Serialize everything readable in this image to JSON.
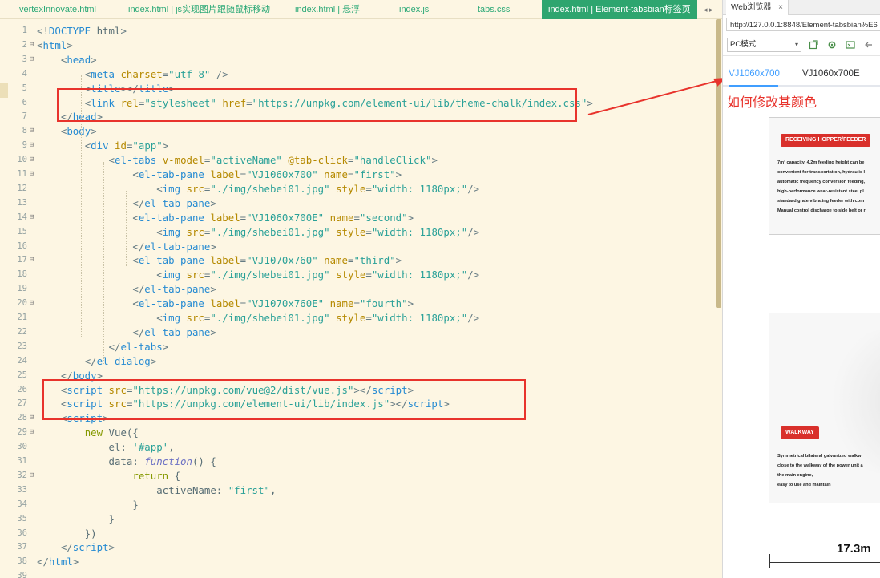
{
  "editor": {
    "tabs": [
      {
        "label": "vertexInnovate.html",
        "active": false
      },
      {
        "label": "index.html | js实现图片跟随鼠标移动",
        "active": false
      },
      {
        "label": "index.html | 悬浮",
        "active": false
      },
      {
        "label": "index.js",
        "active": false
      },
      {
        "label": "tabs.css",
        "active": false
      },
      {
        "label": "index.html | Element-tabsbian标签页",
        "active": true
      }
    ],
    "scroll_arrows": "◂ ▸",
    "lines": [
      [
        [
          "punc",
          "<!"
        ],
        [
          "tag",
          "DOCTYPE"
        ],
        [
          "plain",
          " html"
        ],
        [
          "punc",
          ">"
        ]
      ],
      [
        [
          "punc",
          "<"
        ],
        [
          "tag",
          "html"
        ],
        [
          "punc",
          ">"
        ]
      ],
      [
        [
          "plain",
          "    "
        ],
        [
          "punc",
          "<"
        ],
        [
          "tag",
          "head"
        ],
        [
          "punc",
          ">"
        ]
      ],
      [
        [
          "plain",
          "        "
        ],
        [
          "punc",
          "<"
        ],
        [
          "tag",
          "meta"
        ],
        [
          "plain",
          " "
        ],
        [
          "attr",
          "charset"
        ],
        [
          "punc",
          "="
        ],
        [
          "str",
          "\"utf-8\""
        ],
        [
          "plain",
          " "
        ],
        [
          "punc",
          "/>"
        ]
      ],
      [
        [
          "plain",
          "        "
        ],
        [
          "punc",
          "<"
        ],
        [
          "tag",
          "title"
        ],
        [
          "punc",
          "></"
        ],
        [
          "tag",
          "title"
        ],
        [
          "punc",
          ">"
        ]
      ],
      [
        [
          "plain",
          "        "
        ],
        [
          "punc",
          "<"
        ],
        [
          "tag",
          "link"
        ],
        [
          "plain",
          " "
        ],
        [
          "attr",
          "rel"
        ],
        [
          "punc",
          "="
        ],
        [
          "str",
          "\"stylesheet\""
        ],
        [
          "plain",
          " "
        ],
        [
          "attr",
          "href"
        ],
        [
          "punc",
          "="
        ],
        [
          "str",
          "\"https://unpkg.com/element-ui/lib/theme-chalk/index.css\""
        ],
        [
          "punc",
          ">"
        ]
      ],
      [
        [
          "plain",
          "    "
        ],
        [
          "punc",
          "</"
        ],
        [
          "tag",
          "head"
        ],
        [
          "punc",
          ">"
        ]
      ],
      [
        [
          "plain",
          "    "
        ],
        [
          "punc",
          "<"
        ],
        [
          "tag",
          "body"
        ],
        [
          "punc",
          ">"
        ]
      ],
      [
        [
          "plain",
          "        "
        ],
        [
          "punc",
          "<"
        ],
        [
          "tag",
          "div"
        ],
        [
          "plain",
          " "
        ],
        [
          "attr",
          "id"
        ],
        [
          "punc",
          "="
        ],
        [
          "str",
          "\"app\""
        ],
        [
          "punc",
          ">"
        ]
      ],
      [
        [
          "plain",
          "            "
        ],
        [
          "punc",
          "<"
        ],
        [
          "tag",
          "el-tabs"
        ],
        [
          "plain",
          " "
        ],
        [
          "attr",
          "v-model"
        ],
        [
          "punc",
          "="
        ],
        [
          "str",
          "\"activeName\""
        ],
        [
          "plain",
          " "
        ],
        [
          "attr",
          "@tab-click"
        ],
        [
          "punc",
          "="
        ],
        [
          "str",
          "\"handleClick\""
        ],
        [
          "punc",
          ">"
        ]
      ],
      [
        [
          "plain",
          "                "
        ],
        [
          "punc",
          "<"
        ],
        [
          "tag",
          "el-tab-pane"
        ],
        [
          "plain",
          " "
        ],
        [
          "attr",
          "label"
        ],
        [
          "punc",
          "="
        ],
        [
          "str",
          "\"VJ1060x700\""
        ],
        [
          "plain",
          " "
        ],
        [
          "attr",
          "name"
        ],
        [
          "punc",
          "="
        ],
        [
          "str",
          "\"first\""
        ],
        [
          "punc",
          ">"
        ]
      ],
      [
        [
          "plain",
          "                    "
        ],
        [
          "punc",
          "<"
        ],
        [
          "tag",
          "img"
        ],
        [
          "plain",
          " "
        ],
        [
          "attr",
          "src"
        ],
        [
          "punc",
          "="
        ],
        [
          "str",
          "\"./img/shebei01.jpg\""
        ],
        [
          "plain",
          " "
        ],
        [
          "attr",
          "style"
        ],
        [
          "punc",
          "="
        ],
        [
          "str",
          "\"width: 1180px;\""
        ],
        [
          "punc",
          "/>"
        ]
      ],
      [
        [
          "plain",
          "                "
        ],
        [
          "punc",
          "</"
        ],
        [
          "tag",
          "el-tab-pane"
        ],
        [
          "punc",
          ">"
        ]
      ],
      [
        [
          "plain",
          "                "
        ],
        [
          "punc",
          "<"
        ],
        [
          "tag",
          "el-tab-pane"
        ],
        [
          "plain",
          " "
        ],
        [
          "attr",
          "label"
        ],
        [
          "punc",
          "="
        ],
        [
          "str",
          "\"VJ1060x700E\""
        ],
        [
          "plain",
          " "
        ],
        [
          "attr",
          "name"
        ],
        [
          "punc",
          "="
        ],
        [
          "str",
          "\"second\""
        ],
        [
          "punc",
          ">"
        ]
      ],
      [
        [
          "plain",
          "                    "
        ],
        [
          "punc",
          "<"
        ],
        [
          "tag",
          "img"
        ],
        [
          "plain",
          " "
        ],
        [
          "attr",
          "src"
        ],
        [
          "punc",
          "="
        ],
        [
          "str",
          "\"./img/shebei01.jpg\""
        ],
        [
          "plain",
          " "
        ],
        [
          "attr",
          "style"
        ],
        [
          "punc",
          "="
        ],
        [
          "str",
          "\"width: 1180px;\""
        ],
        [
          "punc",
          "/>"
        ]
      ],
      [
        [
          "plain",
          "                "
        ],
        [
          "punc",
          "</"
        ],
        [
          "tag",
          "el-tab-pane"
        ],
        [
          "punc",
          ">"
        ]
      ],
      [
        [
          "plain",
          "                "
        ],
        [
          "punc",
          "<"
        ],
        [
          "tag",
          "el-tab-pane"
        ],
        [
          "plain",
          " "
        ],
        [
          "attr",
          "label"
        ],
        [
          "punc",
          "="
        ],
        [
          "str",
          "\"VJ1070x760\""
        ],
        [
          "plain",
          " "
        ],
        [
          "attr",
          "name"
        ],
        [
          "punc",
          "="
        ],
        [
          "str",
          "\"third\""
        ],
        [
          "punc",
          ">"
        ]
      ],
      [
        [
          "plain",
          "                    "
        ],
        [
          "punc",
          "<"
        ],
        [
          "tag",
          "img"
        ],
        [
          "plain",
          " "
        ],
        [
          "attr",
          "src"
        ],
        [
          "punc",
          "="
        ],
        [
          "str",
          "\"./img/shebei01.jpg\""
        ],
        [
          "plain",
          " "
        ],
        [
          "attr",
          "style"
        ],
        [
          "punc",
          "="
        ],
        [
          "str",
          "\"width: 1180px;\""
        ],
        [
          "punc",
          "/>"
        ]
      ],
      [
        [
          "plain",
          "                "
        ],
        [
          "punc",
          "</"
        ],
        [
          "tag",
          "el-tab-pane"
        ],
        [
          "punc",
          ">"
        ]
      ],
      [
        [
          "plain",
          "                "
        ],
        [
          "punc",
          "<"
        ],
        [
          "tag",
          "el-tab-pane"
        ],
        [
          "plain",
          " "
        ],
        [
          "attr",
          "label"
        ],
        [
          "punc",
          "="
        ],
        [
          "str",
          "\"VJ1070x760E\""
        ],
        [
          "plain",
          " "
        ],
        [
          "attr",
          "name"
        ],
        [
          "punc",
          "="
        ],
        [
          "str",
          "\"fourth\""
        ],
        [
          "punc",
          ">"
        ]
      ],
      [
        [
          "plain",
          "                    "
        ],
        [
          "punc",
          "<"
        ],
        [
          "tag",
          "img"
        ],
        [
          "plain",
          " "
        ],
        [
          "attr",
          "src"
        ],
        [
          "punc",
          "="
        ],
        [
          "str",
          "\"./img/shebei01.jpg\""
        ],
        [
          "plain",
          " "
        ],
        [
          "attr",
          "style"
        ],
        [
          "punc",
          "="
        ],
        [
          "str",
          "\"width: 1180px;\""
        ],
        [
          "punc",
          "/>"
        ]
      ],
      [
        [
          "plain",
          "                "
        ],
        [
          "punc",
          "</"
        ],
        [
          "tag",
          "el-tab-pane"
        ],
        [
          "punc",
          ">"
        ]
      ],
      [
        [
          "plain",
          "            "
        ],
        [
          "punc",
          "</"
        ],
        [
          "tag",
          "el-tabs"
        ],
        [
          "punc",
          ">"
        ]
      ],
      [
        [
          "plain",
          "        "
        ],
        [
          "punc",
          "</"
        ],
        [
          "tag",
          "el-dialog"
        ],
        [
          "punc",
          ">"
        ]
      ],
      [
        [
          "plain",
          "    "
        ],
        [
          "punc",
          "</"
        ],
        [
          "tag",
          "body"
        ],
        [
          "punc",
          ">"
        ]
      ],
      [
        [
          "plain",
          "    "
        ],
        [
          "punc",
          "<"
        ],
        [
          "tag",
          "script"
        ],
        [
          "plain",
          " "
        ],
        [
          "attr",
          "src"
        ],
        [
          "punc",
          "="
        ],
        [
          "str",
          "\"https://unpkg.com/vue@2/dist/vue.js\""
        ],
        [
          "punc",
          "></"
        ],
        [
          "tag",
          "script"
        ],
        [
          "punc",
          ">"
        ]
      ],
      [
        [
          "plain",
          "    "
        ],
        [
          "punc",
          "<"
        ],
        [
          "tag",
          "script"
        ],
        [
          "plain",
          " "
        ],
        [
          "attr",
          "src"
        ],
        [
          "punc",
          "="
        ],
        [
          "str",
          "\"https://unpkg.com/element-ui/lib/index.js\""
        ],
        [
          "punc",
          "></"
        ],
        [
          "tag",
          "script"
        ],
        [
          "punc",
          ">"
        ]
      ],
      [
        [
          "plain",
          "    "
        ],
        [
          "punc",
          "<"
        ],
        [
          "tag",
          "script"
        ],
        [
          "punc",
          ">"
        ]
      ],
      [
        [
          "plain",
          "        "
        ],
        [
          "kw",
          "new"
        ],
        [
          "plain",
          " Vue({"
        ]
      ],
      [
        [
          "plain",
          "            el: "
        ],
        [
          "str",
          "'#app'"
        ],
        [
          "plain",
          ","
        ]
      ],
      [
        [
          "plain",
          "            data: "
        ],
        [
          "fn",
          "function"
        ],
        [
          "plain",
          "() {"
        ]
      ],
      [
        [
          "plain",
          "                "
        ],
        [
          "kw",
          "return"
        ],
        [
          "plain",
          " {"
        ]
      ],
      [
        [
          "plain",
          "                    activeName: "
        ],
        [
          "str",
          "\"first\""
        ],
        [
          "plain",
          ","
        ]
      ],
      [
        [
          "plain",
          "                }"
        ]
      ],
      [
        [
          "plain",
          "            }"
        ]
      ],
      [
        [
          "plain",
          "        })"
        ]
      ],
      [
        [
          "plain",
          "    "
        ],
        [
          "punc",
          "</"
        ],
        [
          "tag",
          "script"
        ],
        [
          "punc",
          ">"
        ]
      ],
      [
        [
          "punc",
          "</"
        ],
        [
          "tag",
          "html"
        ],
        [
          "punc",
          ">"
        ]
      ],
      []
    ]
  },
  "browser": {
    "tab_label": "Web浏览器",
    "tab_close": "×",
    "url": "http://127.0.0.1:8848/Element-tabsbian%E6",
    "mode_select": "PC模式",
    "mode_caret": "▾",
    "tabs": [
      "VJ1060x700",
      "VJ1060x700E"
    ],
    "active_tab": "VJ1060x700",
    "annotation": "如何修改其颜色",
    "product": {
      "badge1": "RECEIVING HOPPER/FEEDER",
      "desc1": [
        "7m³ capacity, 4.2m feeding height can be",
        "convenient for transportation, hydraulic l",
        "automatic frequency conversion feeding,",
        "high-performance wear-resistant steel pl",
        "standard grate vibrating feeder with com",
        "Manual control discharge to side belt or r"
      ],
      "badge2": "WALKWAY",
      "desc2": [
        "Symmetrical bilateral galvanized walkw",
        "close to the walkway of the power unit a",
        "the main engine,",
        "easy to use and maintain"
      ],
      "dimension": "17.3m"
    }
  },
  "colors": {
    "annotation_red": "#e8332c",
    "element_blue": "#409eff",
    "tab_active_green": "#2ea56f"
  }
}
